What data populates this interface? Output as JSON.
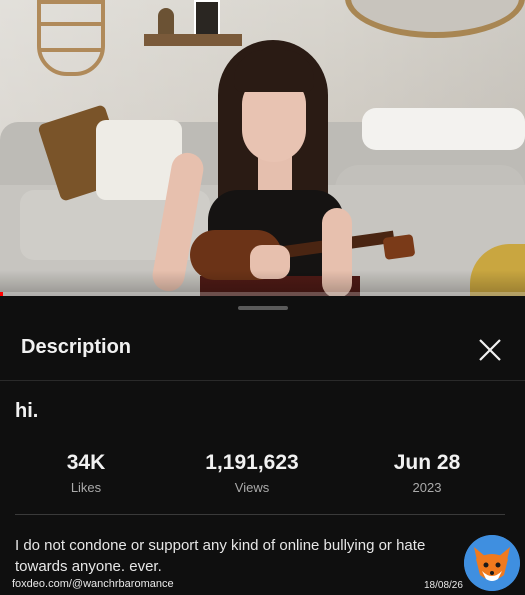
{
  "video": {
    "progress_percent": 0.5,
    "accent_color": "#ff0000"
  },
  "sheet": {
    "title": "Description",
    "close_icon": "close-icon",
    "video_title": "hi.",
    "stats": [
      {
        "value": "34K",
        "label": "Likes"
      },
      {
        "value": "1,191,623",
        "label": "Views"
      },
      {
        "value": "Jun 28",
        "label": "2023"
      }
    ],
    "description": "I do not condone or support any kind of online bullying or hate towards anyone. ever."
  },
  "watermark": {
    "site": "foxdeo.com/@wanchrbaromance",
    "date": "18/08/26",
    "logo_icon": "fox-icon"
  }
}
